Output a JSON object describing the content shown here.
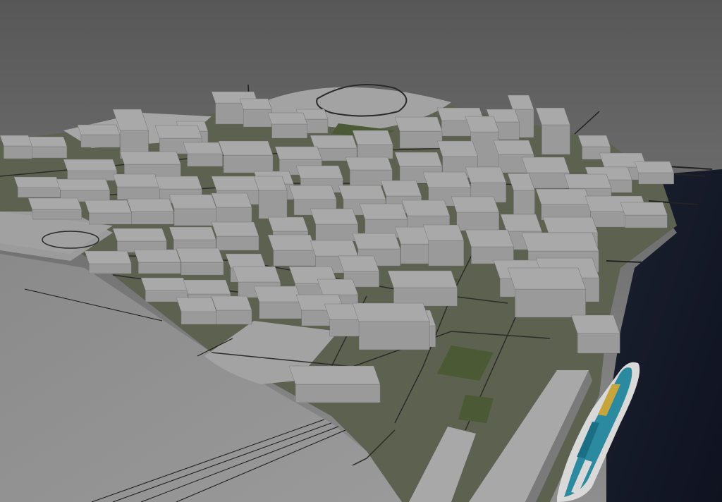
{
  "viewport": {
    "label": "",
    "colors": {
      "sky_top": "#5e5e5e",
      "sky_bottom": "#8c8c8c",
      "ground": "#8e8e8e",
      "water": "#14192a",
      "building_top": "#a9a9a9",
      "building_side": "#7e7e7e",
      "road_line": "#2b2b2b",
      "greenery": "#4c5a36",
      "cruise_ship_deck": "#2c8aa0"
    }
  }
}
